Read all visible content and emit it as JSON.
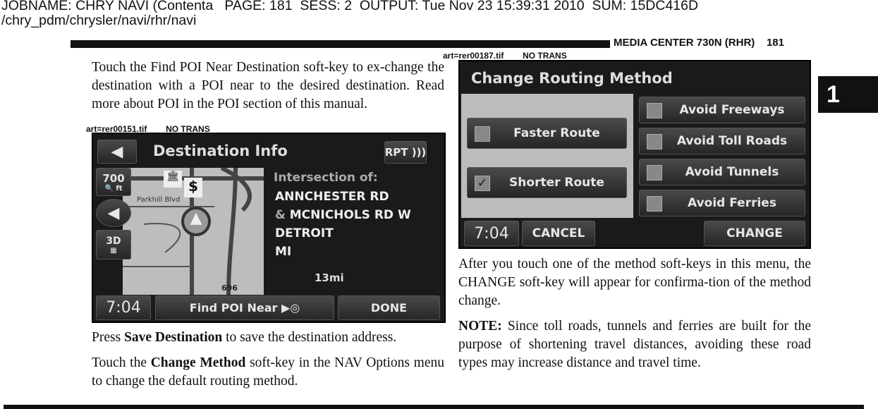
{
  "job_header": {
    "line1": "JOBNAME: CHRY NAVI (Contenta   PAGE: 181  SESS: 2  OUTPUT: Tue Nov 23 15:39:31 2010  SUM: 15DC416D",
    "line2": "/chry_pdm/chrysler/navi/rhr/navi"
  },
  "running_head": "MEDIA CENTER 730N (RHR)    181",
  "section_tab": "1",
  "left": {
    "para1": "Touch the Find POI Near Destination soft-key to ex-change the destination with a POI near to the desired destination. Read more about POI in the POI section of this manual.",
    "caption1": "art=rer00151.tif        NO TRANS",
    "para2_pre": "Press ",
    "para2_bold": "Save Destination",
    "para2_post": " to save the destination address.",
    "para3_pre": "Touch the ",
    "para3_bold": "Change Method",
    "para3_post": " soft-key in the NAV Options menu to change the default routing method."
  },
  "screen1": {
    "title": "Destination Info",
    "rpt": "RPT",
    "scale": "700",
    "scale_unit": "ft",
    "view_mode": "3D",
    "street_label": "Parkhill Blvd",
    "info_heading": "Intersection of:",
    "line1": "ANNCHESTER RD",
    "amp": "&",
    "line2": "MCNICHOLS RD W",
    "city": "DETROIT",
    "state": "MI",
    "distance": "13mi",
    "clock": "7:04",
    "find_poi": "Find POI Near",
    "done": "DONE",
    "highway": "696"
  },
  "right": {
    "caption2": "art=rer00187.tif        NO TRANS",
    "para4": "After you touch one of the method soft-keys in this menu, the CHANGE soft-key will appear for confirma-tion of the method change.",
    "note_label": "NOTE:",
    "note_text": "  Since toll roads, tunnels and ferries are built for the purpose of shortening travel distances, avoiding these road types may increase distance and travel time."
  },
  "screen2": {
    "title": "Change Routing Method",
    "methods": [
      {
        "label": "Faster Route",
        "checked": false
      },
      {
        "label": "Shorter Route",
        "checked": true
      }
    ],
    "avoid": [
      {
        "label": "Avoid Freeways",
        "checked": false
      },
      {
        "label": "Avoid Toll Roads",
        "checked": false
      },
      {
        "label": "Avoid Tunnels",
        "checked": false
      },
      {
        "label": "Avoid Ferries",
        "checked": false
      }
    ],
    "clock": "7:04",
    "cancel": "CANCEL",
    "change": "CHANGE"
  }
}
